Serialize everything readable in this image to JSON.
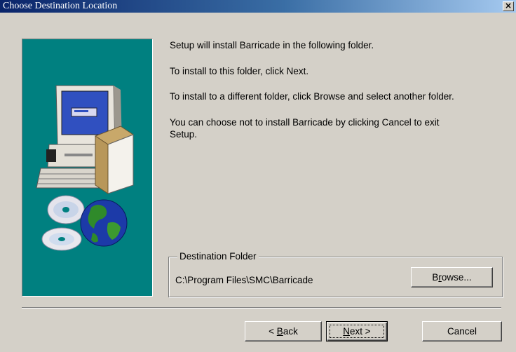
{
  "window": {
    "title": "Choose Destination Location",
    "close_glyph": "×"
  },
  "messages": {
    "line1": "Setup will install Barricade in the following folder.",
    "line2": "To install to this folder, click Next.",
    "line3": "To install to a different folder, click Browse and select another folder.",
    "line4a": "You can choose not to install Barricade by clicking Cancel to exit",
    "line4b": "Setup."
  },
  "destination": {
    "legend": "Destination Folder",
    "path": "C:\\Program Files\\SMC\\Barricade",
    "browse_pre": "B",
    "browse_mnemonic": "r",
    "browse_post": "owse..."
  },
  "buttons": {
    "back_pre": "< ",
    "back_mnemonic": "B",
    "back_post": "ack",
    "next_mnemonic": "N",
    "next_post": "ext >",
    "cancel": "Cancel"
  },
  "colors": {
    "titlebar_start": "#0a246a",
    "titlebar_end": "#a6caf0",
    "art_background": "#008080",
    "dialog_face": "#d4d0c8"
  },
  "icons": [
    "close-icon",
    "computer-icon",
    "cd-disc-icon",
    "globe-icon",
    "software-box-icon"
  ]
}
